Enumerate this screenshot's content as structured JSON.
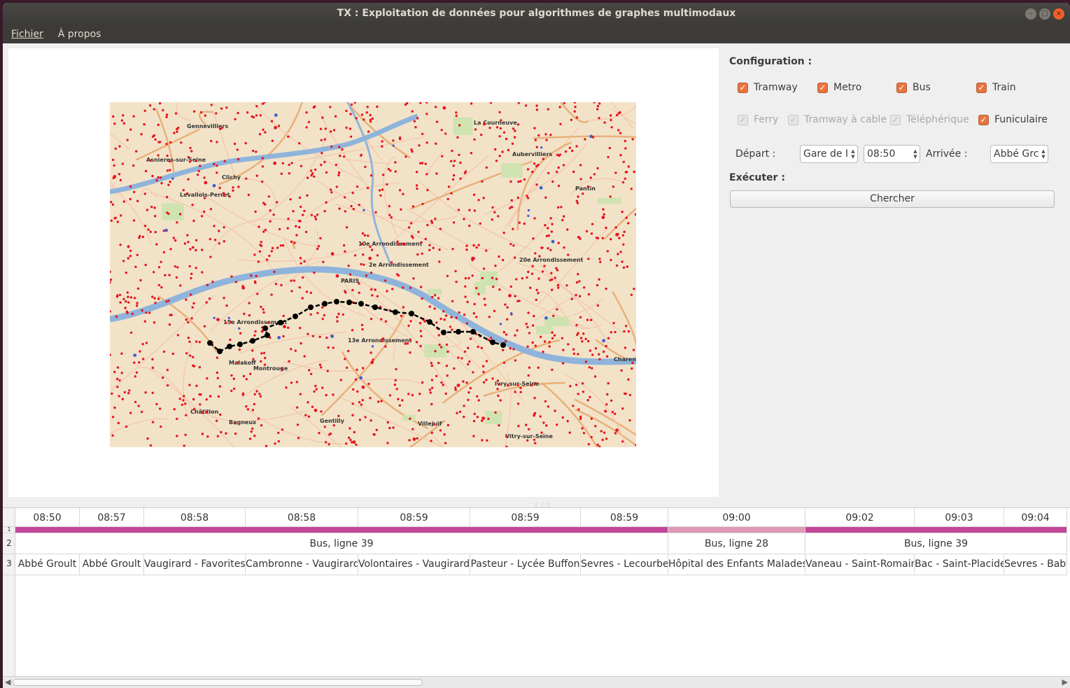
{
  "window": {
    "title": "TX : Exploitation de données pour algorithmes de graphes multimodaux"
  },
  "menu": {
    "fichier": "Fichier",
    "apropos": "À propos"
  },
  "config": {
    "title": "Configuration :",
    "transports": [
      {
        "label": "Tramway",
        "checked": true,
        "enabled": true
      },
      {
        "label": "Metro",
        "checked": true,
        "enabled": true
      },
      {
        "label": "Bus",
        "checked": true,
        "enabled": true
      },
      {
        "label": "Train",
        "checked": true,
        "enabled": true
      },
      {
        "label": "Ferry",
        "checked": true,
        "enabled": false
      },
      {
        "label": "Tramway à cable",
        "checked": true,
        "enabled": false
      },
      {
        "label": "Téléphérique",
        "checked": true,
        "enabled": false
      },
      {
        "label": "Funiculaire",
        "checked": true,
        "enabled": true
      }
    ],
    "depart_label": "Départ :",
    "depart_value": "Gare de I",
    "time_value": "08:50",
    "arrivee_label": "Arrivée :",
    "arrivee_value": "Abbé Grc",
    "executer_label": "Exécuter :",
    "search_button": "Chercher"
  },
  "map": {
    "place_labels": [
      "Gennevilliers",
      "La Courneuve",
      "Aubervilliers",
      "Asnieres-sur-Seine",
      "Clichy",
      "Levallois-Perret",
      "Pantin",
      "10e Arrondissement",
      "2e Arrondissement",
      "20e Arrondissement",
      "PARIS",
      "15e Arrondissement",
      "13e Arrondissement",
      "Ivry-sur-Seine",
      "Malakoff",
      "Montrouge",
      "Châtillon",
      "Bagneux",
      "Villejuif",
      "Vitry-sur-Seine",
      "Gentilly",
      "Charenton"
    ],
    "route_color": "#000000",
    "stop_color": "#e8141e"
  },
  "table": {
    "row_numbers": [
      "1",
      "2",
      "3"
    ],
    "columns": [
      {
        "time": "08:50",
        "stop": "Abbé Groult",
        "color": "#c2469a"
      },
      {
        "time": "08:57",
        "stop": "Abbé Groult",
        "color": "#c2469a"
      },
      {
        "time": "08:58",
        "stop": "Vaugirard - Favorites",
        "color": "#c2469a"
      },
      {
        "time": "08:58",
        "stop": "Cambronne - Vaugirard",
        "color": "#c2469a"
      },
      {
        "time": "08:59",
        "stop": "Volontaires - Vaugirard",
        "color": "#c2469a"
      },
      {
        "time": "08:59",
        "stop": "Pasteur - Lycée Buffon",
        "color": "#c2469a"
      },
      {
        "time": "08:59",
        "stop": "Sevres - Lecourbe",
        "color": "#c2469a"
      },
      {
        "time": "09:00",
        "stop": "Hôpital des Enfants Malades",
        "color": "#e199b6"
      },
      {
        "time": "09:02",
        "stop": "Vaneau - Saint-Romain",
        "color": "#c2469a"
      },
      {
        "time": "09:03",
        "stop": "Bac - Saint-Placide",
        "color": "#c2469a"
      },
      {
        "time": "09:04",
        "stop": "Sevres - Babylone",
        "color": "#c2469a"
      }
    ],
    "line_spans": [
      {
        "label": "Bus, ligne 39"
      },
      {
        "label": "Bus, ligne 28"
      },
      {
        "label": "Bus, ligne 39"
      }
    ]
  }
}
